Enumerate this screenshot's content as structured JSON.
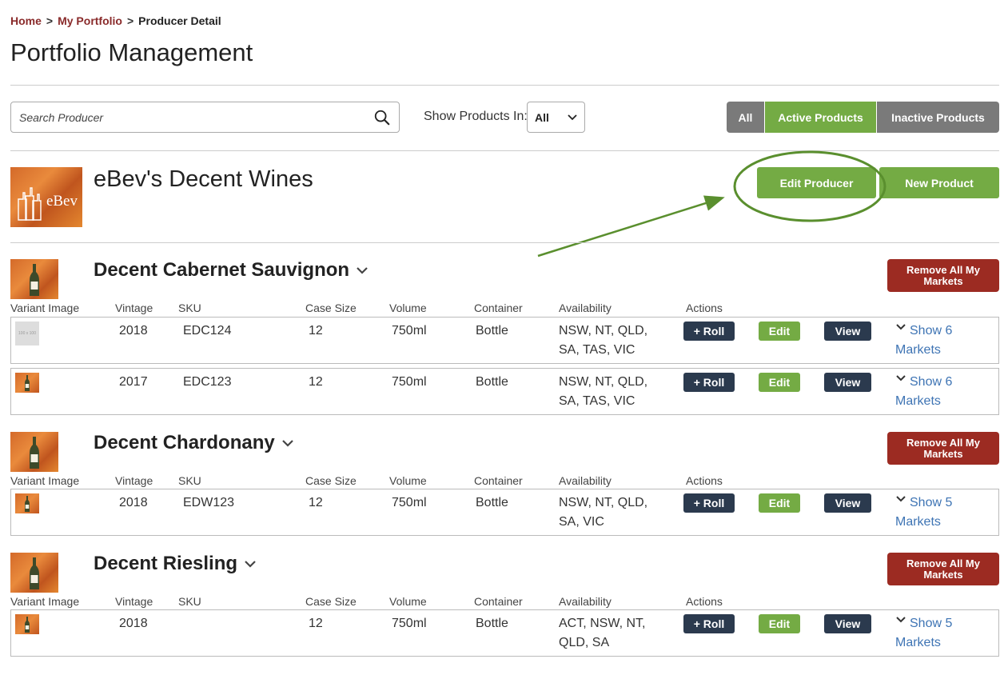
{
  "breadcrumb": {
    "home": "Home",
    "portfolio": "My Portfolio",
    "current": "Producer Detail",
    "separator": ">"
  },
  "page_title": "Portfolio Management",
  "search": {
    "placeholder": "Search Producer",
    "value": ""
  },
  "show_products": {
    "label": "Show Products In:",
    "selected": "All"
  },
  "filters": {
    "all": "All",
    "active": "Active Products",
    "inactive": "Inactive Products",
    "selected": "Active Products"
  },
  "producer": {
    "name": "eBev's Decent Wines",
    "logo_text": "eBev",
    "edit_label": "Edit Producer",
    "new_product_label": "New Product"
  },
  "columns": {
    "variant_image": "Variant Image",
    "vintage": "Vintage",
    "sku": "SKU",
    "case_size": "Case Size",
    "volume": "Volume",
    "container": "Container",
    "availability": "Availability",
    "actions": "Actions"
  },
  "actions": {
    "roll": "+ Roll",
    "edit": "Edit",
    "view": "View",
    "markets_word": "Markets"
  },
  "remove_label": "Remove All My Markets",
  "placeholder_thumb_text": "100 x 100",
  "products": [
    {
      "name": "Decent Cabernet Sauvignon",
      "variants": [
        {
          "vintage": "2018",
          "sku": "EDC124",
          "case_size": "12",
          "volume": "750ml",
          "container": "Bottle",
          "availability_line1": "NSW, NT, QLD,",
          "availability_line2": "SA, TAS, VIC",
          "markets_show": "Show 6",
          "image": "placeholder"
        },
        {
          "vintage": "2017",
          "sku": "EDC123",
          "case_size": "12",
          "volume": "750ml",
          "container": "Bottle",
          "availability_line1": "NSW, NT, QLD,",
          "availability_line2": "SA, TAS, VIC",
          "markets_show": "Show 6",
          "image": "wine"
        }
      ]
    },
    {
      "name": "Decent Chardonany",
      "variants": [
        {
          "vintage": "2018",
          "sku": "EDW123",
          "case_size": "12",
          "volume": "750ml",
          "container": "Bottle",
          "availability_line1": "NSW, NT, QLD,",
          "availability_line2": "SA, VIC",
          "markets_show": "Show 5",
          "image": "wine"
        }
      ]
    },
    {
      "name": "Decent Riesling",
      "variants": [
        {
          "vintage": "2018",
          "sku": "",
          "case_size": "12",
          "volume": "750ml",
          "container": "Bottle",
          "availability_line1": "ACT, NSW, NT,",
          "availability_line2": "QLD, SA",
          "markets_show": "Show 5",
          "image": "wine"
        }
      ]
    }
  ],
  "colors": {
    "brand_red": "#8a2b2b",
    "remove_red": "#9c2b22",
    "green": "#74ab44",
    "dark_navy": "#2b3a4e",
    "link_blue": "#3e74b4",
    "annotation_green": "#5a8f2e"
  }
}
